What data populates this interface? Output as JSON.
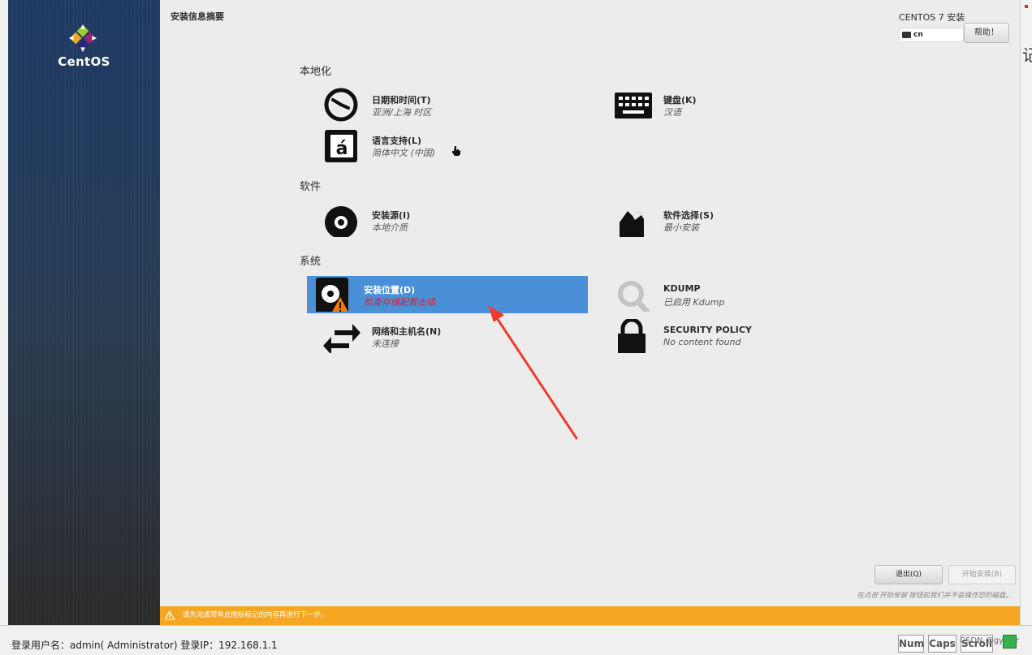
{
  "window": {
    "title": "安装信息摘要",
    "product": "CENTOS 7 安装",
    "keyboard_layout": "cn",
    "help_label": "帮助！"
  },
  "brand": {
    "logo_text": "CentOS"
  },
  "sections": {
    "localization": "本地化",
    "software": "软件",
    "system": "系统"
  },
  "spokes": {
    "datetime": {
      "label": "日期和时间(T)",
      "status": "亚洲/上海 时区",
      "icon": "clock-icon"
    },
    "keyboard": {
      "label": "键盘(K)",
      "status": "汉语",
      "icon": "keyboard-icon"
    },
    "language": {
      "label": "语言支持(L)",
      "status": "简体中文 (中国)",
      "icon": "language-icon"
    },
    "source": {
      "label": "安装源(I)",
      "status": "本地介质",
      "icon": "disc-icon"
    },
    "software_selection": {
      "label": "软件选择(S)",
      "status": "最小安装",
      "icon": "package-icon"
    },
    "destination": {
      "label": "安装位置(D)",
      "status": "检查存储配置出错",
      "icon": "hard-disk-warning-icon"
    },
    "kdump": {
      "label": "KDUMP",
      "status": "已启用 Kdump",
      "icon": "search-icon"
    },
    "network": {
      "label": "网络和主机名(N)",
      "status": "未连接",
      "icon": "network-arrows-icon"
    },
    "security": {
      "label": "SECURITY POLICY",
      "status": "No content found",
      "icon": "lock-icon"
    }
  },
  "buttons": {
    "quit": "退出(Q)",
    "begin": "开始安装(B)"
  },
  "hint": "在点击'开始安装'按钮前我们并不会操作您的磁盘。",
  "warning_bar": "请先完成带有此图标标记的内容再进行下一步。",
  "statusbar": {
    "login_info": "登录用户名：admin( Administrator)   登录IP：192.168.1.1",
    "num_label": "Num",
    "caps_label": "Caps",
    "scroll_label": "Scroll",
    "watermark": "CSDN @gyf_ar"
  },
  "colors": {
    "selection": "#4a90d9",
    "warning": "#f5a623",
    "error_text": "#d0273a",
    "annotation_arrow": "#f03c2c"
  }
}
